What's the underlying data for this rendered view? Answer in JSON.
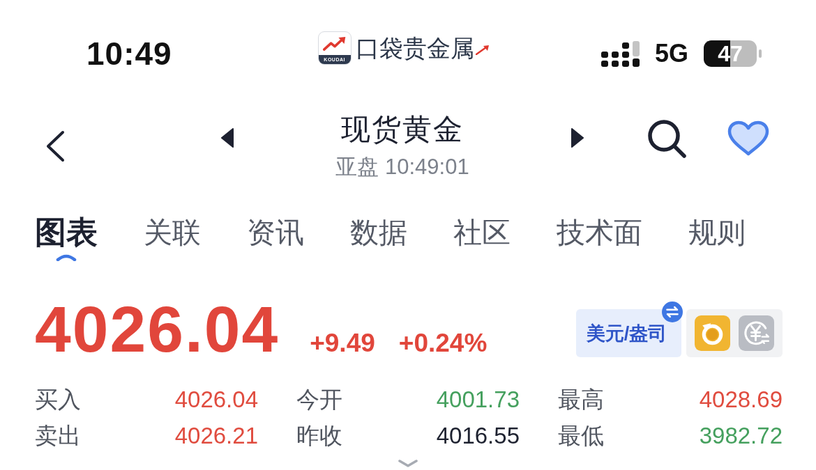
{
  "status_bar": {
    "time": "10:49",
    "network": "5G",
    "battery": "47"
  },
  "logo": {
    "badge": "KOUDAI",
    "wordmark": "口袋贵金属"
  },
  "header": {
    "title": "现货黄金",
    "subtitle": "亚盘 10:49:01",
    "favorite": true
  },
  "tabs": [
    {
      "label": "图表",
      "selected": true
    },
    {
      "label": "关联",
      "selected": false
    },
    {
      "label": "资讯",
      "selected": false
    },
    {
      "label": "数据",
      "selected": false
    },
    {
      "label": "社区",
      "selected": false
    },
    {
      "label": "技术面",
      "selected": false
    },
    {
      "label": "规则",
      "selected": false
    }
  ],
  "quote": {
    "price": "4026.04",
    "change": "+9.49",
    "change_percent": "+0.24%",
    "rising": true,
    "unit": "美元/盎司"
  },
  "stats": [
    {
      "label": "买入",
      "value": "4026.04",
      "color": "#e04c3f"
    },
    {
      "label": "今开",
      "value": "4001.73",
      "color": "#45a05e"
    },
    {
      "label": "最高",
      "value": "4028.69",
      "color": "#e04c3f"
    },
    {
      "label": "卖出",
      "value": "4026.21",
      "color": "#e04c3f"
    },
    {
      "label": "昨收",
      "value": "4016.55",
      "color": "#1e2230"
    },
    {
      "label": "最低",
      "value": "3982.72",
      "color": "#45a05e"
    }
  ]
}
